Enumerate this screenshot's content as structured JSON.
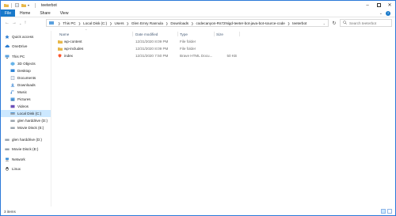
{
  "window": {
    "title": "teeterbot",
    "controls": [
      "minimize-icon",
      "maximize-icon",
      "close-icon"
    ],
    "accent": "#1979ca"
  },
  "ribbon": {
    "tabs": [
      "File",
      "Home",
      "Share",
      "View"
    ],
    "expand_icon": "chevron-down-icon",
    "help_icon": "help-icon"
  },
  "address": {
    "breadcrumbs": [
      "This PC",
      "Local Disk (C:)",
      "Users",
      "Glen Emry Rannula",
      "Downloads",
      "codecanyon-Rs72Nigd-teeter-bot-java-bot-source-code",
      "teeterbot"
    ],
    "search_placeholder": "Search teeterbot"
  },
  "nav": {
    "items": [
      {
        "label": "Quick access",
        "icon": "star-icon"
      },
      {
        "label": "OneDrive",
        "icon": "cloud-icon"
      },
      {
        "label": "This PC",
        "icon": "computer-icon"
      },
      {
        "label": "3D Objects",
        "icon": "cube-icon"
      },
      {
        "label": "Desktop",
        "icon": "desktop-icon"
      },
      {
        "label": "Documents",
        "icon": "documents-icon"
      },
      {
        "label": "Downloads",
        "icon": "download-icon"
      },
      {
        "label": "Music",
        "icon": "music-icon"
      },
      {
        "label": "Pictures",
        "icon": "pictures-icon"
      },
      {
        "label": "Videos",
        "icon": "videos-icon"
      },
      {
        "label": "Local Disk (C:)",
        "icon": "drive-icon"
      },
      {
        "label": "glen harddrive (D:)",
        "icon": "drive-icon"
      },
      {
        "label": "Movie Disck (E:)",
        "icon": "drive-icon"
      },
      {
        "label": "glen harddrive (D:)",
        "icon": "drive-icon"
      },
      {
        "label": "Movie Disck (E:)",
        "icon": "drive-icon"
      },
      {
        "label": "Network",
        "icon": "network-icon"
      },
      {
        "label": "Linux",
        "icon": "linux-icon"
      }
    ]
  },
  "table": {
    "headers": [
      "Name",
      "Date modified",
      "Type",
      "Size"
    ],
    "rows": [
      {
        "name": "wp-content",
        "date": "12/31/2020 8:09 PM",
        "type": "File folder",
        "size": "",
        "icon": "folder-icon"
      },
      {
        "name": "wp-includes",
        "date": "12/31/2020 8:09 PM",
        "type": "File folder",
        "size": "",
        "icon": "folder-icon"
      },
      {
        "name": "index",
        "date": "12/31/2020 7:50 PM",
        "type": "Brave HTML Docu...",
        "size": "50 KB",
        "icon": "brave-html-icon"
      }
    ]
  },
  "status": {
    "count": "3 items"
  }
}
